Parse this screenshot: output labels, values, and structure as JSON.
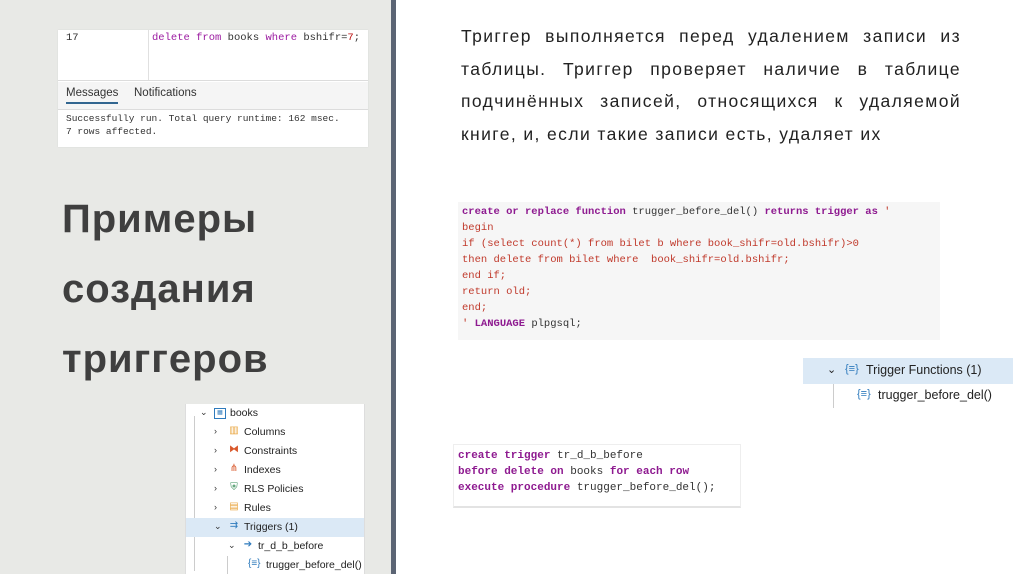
{
  "slide": {
    "title_lines": [
      "Примеры",
      "создания",
      "триггеров"
    ],
    "description": "Триггер  выполняется перед удалением записи из таблицы.  Триггер проверяет наличие  в таблице подчинённых записей, относящихся к удаляемой книге, и, если такие записи есть, удаляет их"
  },
  "query_tool": {
    "line_number": "17",
    "query_kw1": "delete",
    "query_kw2": "from",
    "query_table": "books",
    "query_kw3": "where",
    "query_cond": "bshifr=",
    "query_num": "7",
    "query_end": ";",
    "tab_messages": "Messages",
    "tab_notifications": "Notifications",
    "message_line1": "Successfully run. Total query runtime: 162 msec.",
    "message_line2": "7 rows affected."
  },
  "object_tree": {
    "items": [
      {
        "label": "books",
        "icon": "table-icon",
        "expanded": true
      },
      {
        "label": "Columns",
        "icon": "columns-icon",
        "expanded": false
      },
      {
        "label": "Constraints",
        "icon": "constraints-icon",
        "expanded": false
      },
      {
        "label": "Indexes",
        "icon": "indexes-icon",
        "expanded": false
      },
      {
        "label": "RLS Policies",
        "icon": "rls-icon",
        "expanded": false
      },
      {
        "label": "Rules",
        "icon": "rules-icon",
        "expanded": false
      },
      {
        "label": "Triggers (1)",
        "icon": "triggers-icon",
        "expanded": true,
        "selected": true
      },
      {
        "label": "tr_d_b_before",
        "icon": "trigger-icon",
        "expanded": true
      },
      {
        "label": "trugger_before_del()",
        "icon": "function-icon"
      }
    ]
  },
  "function_code": {
    "line1": {
      "a": "create or replace function",
      "b": " trugger_before_del() ",
      "c": "returns trigger as",
      "d": " '"
    },
    "line2": "begin",
    "line3": "if (select count(*) from bilet b where book_shifr=old.bshifr)>0",
    "line4": "then delete from bilet where  book_shifr=old.bshifr;",
    "line5": "end if;",
    "line6": "return old;",
    "line7": "end;",
    "line8": {
      "a": "' ",
      "b": "LANGUAGE",
      "c": " plpgsql;"
    }
  },
  "function_tree": {
    "group_label": "Trigger Functions (1)",
    "item_label": "trugger_before_del()"
  },
  "trigger_code": {
    "line1": {
      "a": "create trigger",
      "b": " tr_d_b_before"
    },
    "line2": {
      "a": "before delete on",
      "b": " books ",
      "c": "for each row"
    },
    "line3": {
      "a": "execute procedure",
      "b": " trugger_before_del();"
    }
  },
  "colors": {
    "left_panel_bg": "#e8e9e6",
    "divider": "#5b6474",
    "keyword": "#8e1a90",
    "code_text": "#c0392b",
    "selection": "#dbe9f6"
  }
}
